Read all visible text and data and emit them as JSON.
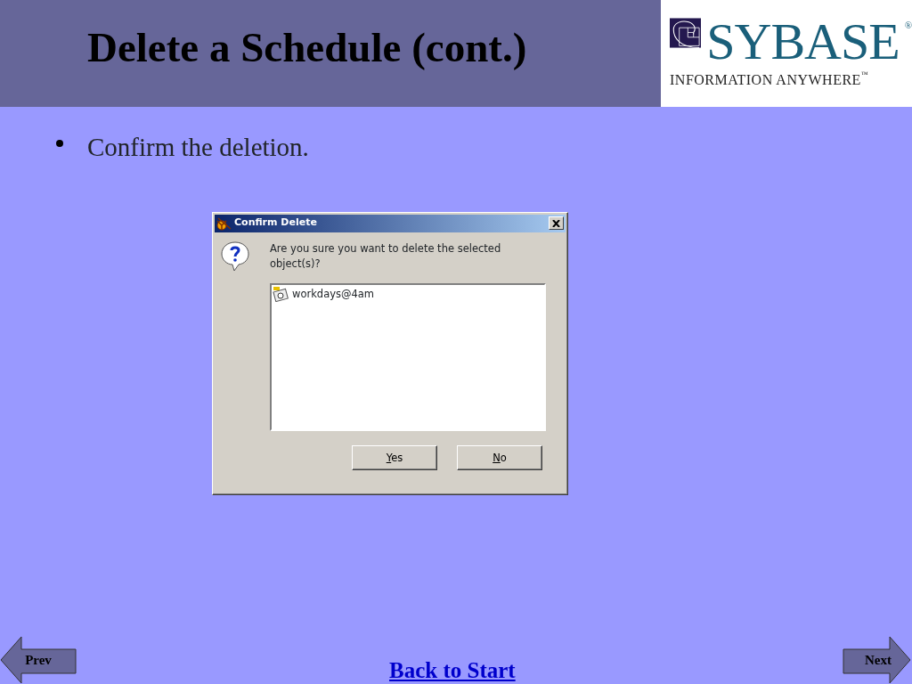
{
  "header": {
    "title": "Delete a Schedule (cont.)",
    "logo": {
      "wordmark": "SYBASE",
      "registered": "®",
      "tagline": "INFORMATION ANYWHERE",
      "trademark": "™"
    }
  },
  "bullets": [
    "Confirm the deletion."
  ],
  "dialog": {
    "title": "Confirm Delete",
    "message": "Are you sure you want to delete the selected object(s)?",
    "items": [
      {
        "label": "workdays@4am"
      }
    ],
    "buttons": [
      {
        "mnemonic": "Y",
        "label_rest": "es"
      },
      {
        "mnemonic": "N",
        "label_rest": "o"
      }
    ]
  },
  "footer": {
    "prev": "Prev",
    "back": "Back to Start",
    "next": "Next"
  }
}
